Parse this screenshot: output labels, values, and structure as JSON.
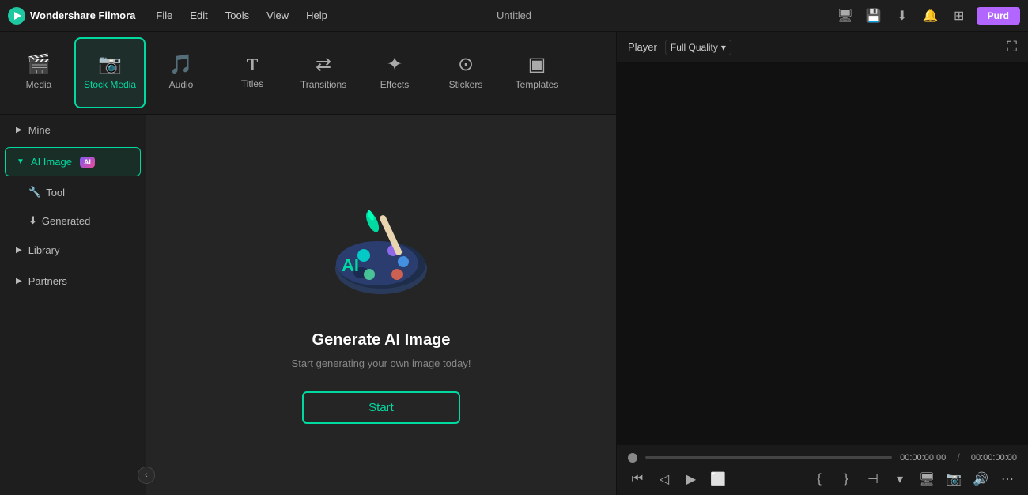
{
  "app": {
    "logo_text": "Wondershare Filmora",
    "title": "Untitled"
  },
  "menu": {
    "items": [
      "File",
      "Edit",
      "Tools",
      "View",
      "Help"
    ]
  },
  "tabs": [
    {
      "id": "media",
      "label": "Media",
      "icon": "🎬"
    },
    {
      "id": "stock-media",
      "label": "Stock Media",
      "icon": "📷",
      "active": true
    },
    {
      "id": "audio",
      "label": "Audio",
      "icon": "🎵"
    },
    {
      "id": "titles",
      "label": "Titles",
      "icon": "T"
    },
    {
      "id": "transitions",
      "label": "Transitions",
      "icon": "↔"
    },
    {
      "id": "effects",
      "label": "Effects",
      "icon": "✨"
    },
    {
      "id": "stickers",
      "label": "Stickers",
      "icon": "⭕"
    },
    {
      "id": "templates",
      "label": "Templates",
      "icon": "⬛"
    }
  ],
  "sidebar": {
    "items": [
      {
        "id": "mine",
        "label": "Mine",
        "expanded": false,
        "chevron": "▶"
      },
      {
        "id": "ai-image",
        "label": "AI Image",
        "expanded": true,
        "chevron": "▼",
        "badge": "AI"
      },
      {
        "id": "tool",
        "label": "Tool",
        "sub": true,
        "active": false,
        "icon": "🔧"
      },
      {
        "id": "generated",
        "label": "Generated",
        "sub": true,
        "icon": "⬇"
      },
      {
        "id": "library",
        "label": "Library",
        "expanded": false,
        "chevron": "▶"
      },
      {
        "id": "partners",
        "label": "Partners",
        "expanded": false,
        "chevron": "▶"
      }
    ]
  },
  "center": {
    "title": "Generate AI Image",
    "subtitle": "Start generating your own image today!",
    "start_label": "Start"
  },
  "player": {
    "label": "Player",
    "quality": "Full Quality",
    "time_current": "00:00:00:00",
    "time_total": "00:00:00:00",
    "separator": "/"
  },
  "titlebar_btn": "Purd"
}
